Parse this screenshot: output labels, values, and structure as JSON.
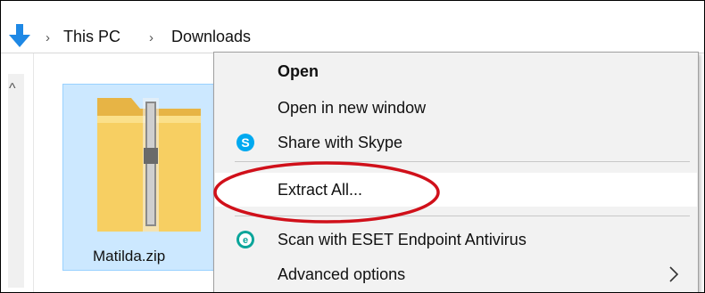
{
  "breadcrumb": {
    "items": [
      "This PC",
      "Downloads"
    ]
  },
  "file": {
    "name": "Matilda.zip"
  },
  "context_menu": {
    "items": [
      {
        "label": "Open",
        "bold": true
      },
      {
        "label": "Open in new window"
      },
      {
        "label": "Share with Skype",
        "icon": "skype-icon"
      },
      {
        "label": "Extract All...",
        "highlighted": true
      },
      {
        "label": "Scan with ESET Endpoint Antivirus",
        "icon": "eset-icon"
      },
      {
        "label": "Advanced options",
        "has_submenu": true
      }
    ]
  },
  "colors": {
    "selection_fill": "#cce8ff",
    "selection_border": "#99d1ff",
    "menu_background": "#f2f2f2",
    "annotation": "#d0101a",
    "skype": "#00a9f0",
    "eset": "#0aa59a",
    "nav_arrow": "#1e88e5"
  }
}
